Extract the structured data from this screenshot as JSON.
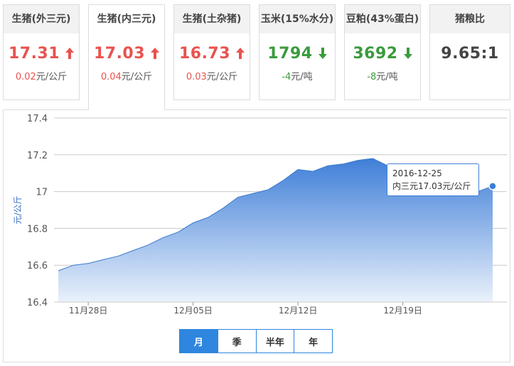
{
  "cards": [
    {
      "title": "生猪(外三元)",
      "price": "17.31",
      "direction": "up",
      "change": "0.02",
      "unit": "元/公斤"
    },
    {
      "title": "生猪(内三元)",
      "price": "17.03",
      "direction": "up",
      "change": "0.04",
      "unit": "元/公斤"
    },
    {
      "title": "生猪(土杂猪)",
      "price": "16.73",
      "direction": "up",
      "change": "0.03",
      "unit": "元/公斤"
    },
    {
      "title": "玉米(15%水分)",
      "price": "1794",
      "direction": "down",
      "change": "-4",
      "unit": "元/吨"
    },
    {
      "title": "豆粕(43%蛋白)",
      "price": "3692",
      "direction": "down",
      "change": "-8",
      "unit": "元/吨"
    },
    {
      "title": "猪粮比",
      "price": "9.65:1",
      "direction": "none",
      "change": "",
      "unit": ""
    }
  ],
  "colors": {
    "up": "#e8534f",
    "down": "#3a9b3c",
    "accent": "#2f86de",
    "area_top": "#3f7fd8",
    "area_bottom": "#eaf1fb"
  },
  "tooltip": {
    "date": "2016-12-25",
    "label": "内三元17.03元/公斤"
  },
  "period_tabs": [
    {
      "label": "月",
      "active": true
    },
    {
      "label": "季",
      "active": false
    },
    {
      "label": "半年",
      "active": false
    },
    {
      "label": "年",
      "active": false
    }
  ],
  "chart_data": {
    "type": "area",
    "ylabel": "元/公斤",
    "ylim": [
      16.4,
      17.4
    ],
    "yticks": [
      "17.4",
      "17.2",
      "17",
      "16.8",
      "16.6",
      "16.4"
    ],
    "xticks": [
      {
        "label": "11月28日",
        "x": "2016-11-28"
      },
      {
        "label": "12月05日",
        "x": "2016-12-05"
      },
      {
        "label": "12月12日",
        "x": "2016-12-12"
      },
      {
        "label": "12月19日",
        "x": "2016-12-19"
      }
    ],
    "grid": true,
    "series": [
      {
        "x": [
          "2016-11-26",
          "2016-11-27",
          "2016-11-28",
          "2016-11-29",
          "2016-11-30",
          "2016-12-01",
          "2016-12-02",
          "2016-12-03",
          "2016-12-04",
          "2016-12-05",
          "2016-12-06",
          "2016-12-07",
          "2016-12-08",
          "2016-12-09",
          "2016-12-10",
          "2016-12-11",
          "2016-12-12",
          "2016-12-13",
          "2016-12-14",
          "2016-12-15",
          "2016-12-16",
          "2016-12-17",
          "2016-12-18",
          "2016-12-19",
          "2016-12-20",
          "2016-12-21",
          "2016-12-22",
          "2016-12-23",
          "2016-12-24",
          "2016-12-25"
        ],
        "y": [
          16.57,
          16.6,
          16.61,
          16.63,
          16.65,
          16.68,
          16.71,
          16.75,
          16.78,
          16.83,
          16.86,
          16.91,
          16.97,
          16.99,
          17.01,
          17.06,
          17.12,
          17.11,
          17.14,
          17.15,
          17.17,
          17.18,
          17.14,
          17.08,
          17.04,
          17.02,
          17.01,
          17.02,
          17.0,
          17.03
        ]
      }
    ]
  }
}
